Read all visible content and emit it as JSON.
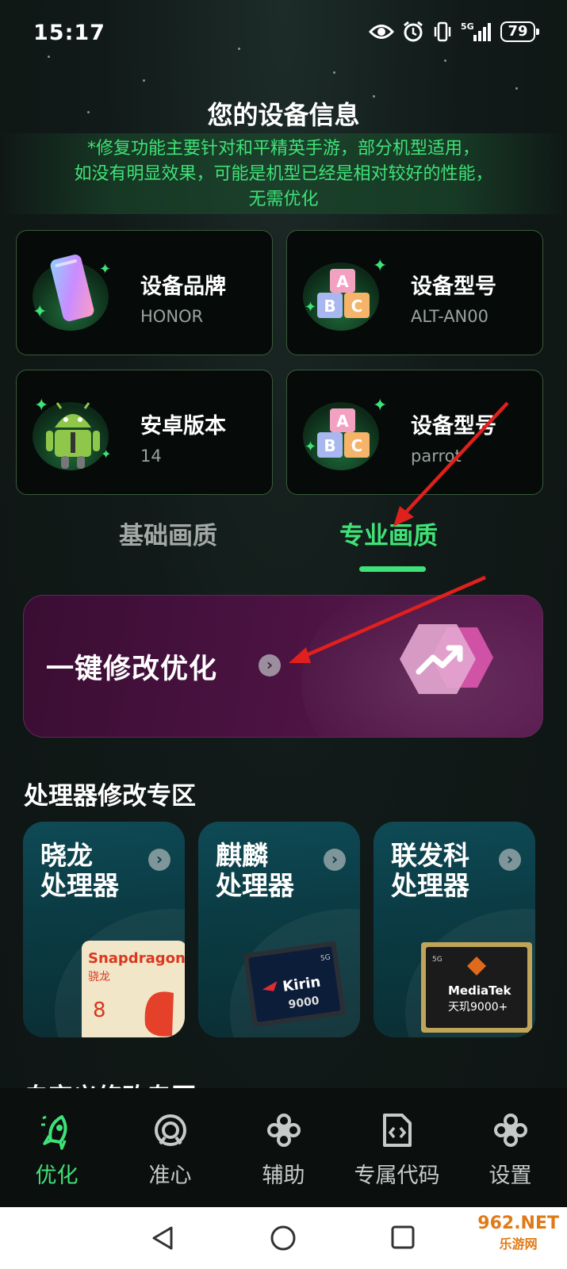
{
  "status_bar": {
    "time": "15:17",
    "network": "5G",
    "battery": "79"
  },
  "header": {
    "title": "您的设备信息",
    "notice_lines": [
      "*修复功能主要针对和平精英手游，部分机型适用，",
      "如没有明显效果，可能是机型已经是相对较好的性能，",
      "无需优化"
    ]
  },
  "device_cards": [
    {
      "label": "设备品牌",
      "value": "HONOR",
      "icon": "phone-icon"
    },
    {
      "label": "设备型号",
      "value": "ALT-AN00",
      "icon": "abc-blocks-icon"
    },
    {
      "label": "安卓版本",
      "value": "14",
      "icon": "android-icon"
    },
    {
      "label": "设备型号",
      "value": "parrot",
      "icon": "abc-blocks-icon"
    }
  ],
  "tabs": [
    {
      "label": "基础画质",
      "active": false
    },
    {
      "label": "专业画质",
      "active": true
    }
  ],
  "banner": {
    "title": "一键修改优化",
    "icon": "trend-hexagon-icon"
  },
  "processor_section": {
    "title": "处理器修改专区",
    "cards": [
      {
        "title": "晓龙\n处理器",
        "chip": "snapdragon-chip",
        "chip_text": [
          "Snapdragon",
          "骁龙",
          "8"
        ]
      },
      {
        "title": "麒麟\n处理器",
        "chip": "kirin-chip",
        "chip_text": [
          "5G",
          "Kirin",
          "9000"
        ]
      },
      {
        "title": "联发科\n处理器",
        "chip": "mediatek-chip",
        "chip_text": [
          "5G",
          "MediaTek",
          "天玑9000+"
        ]
      }
    ]
  },
  "next_section_title": "自定义修改专区",
  "bottom_nav": [
    {
      "label": "优化",
      "icon": "rocket-icon",
      "active": true
    },
    {
      "label": "准心",
      "icon": "crosshair-icon",
      "active": false
    },
    {
      "label": "辅助",
      "icon": "assist-icon",
      "active": false
    },
    {
      "label": "专属代码",
      "icon": "code-file-icon",
      "active": false
    },
    {
      "label": "设置",
      "icon": "settings-icon",
      "active": false
    }
  ],
  "watermark": {
    "brand": "962.NET",
    "sub": "乐游网"
  },
  "colors": {
    "accent": "#3fe277",
    "background": "#0f1614",
    "banner": "#4b1342",
    "proc_card": "#0b3c45",
    "arrow": "#e0201c"
  }
}
